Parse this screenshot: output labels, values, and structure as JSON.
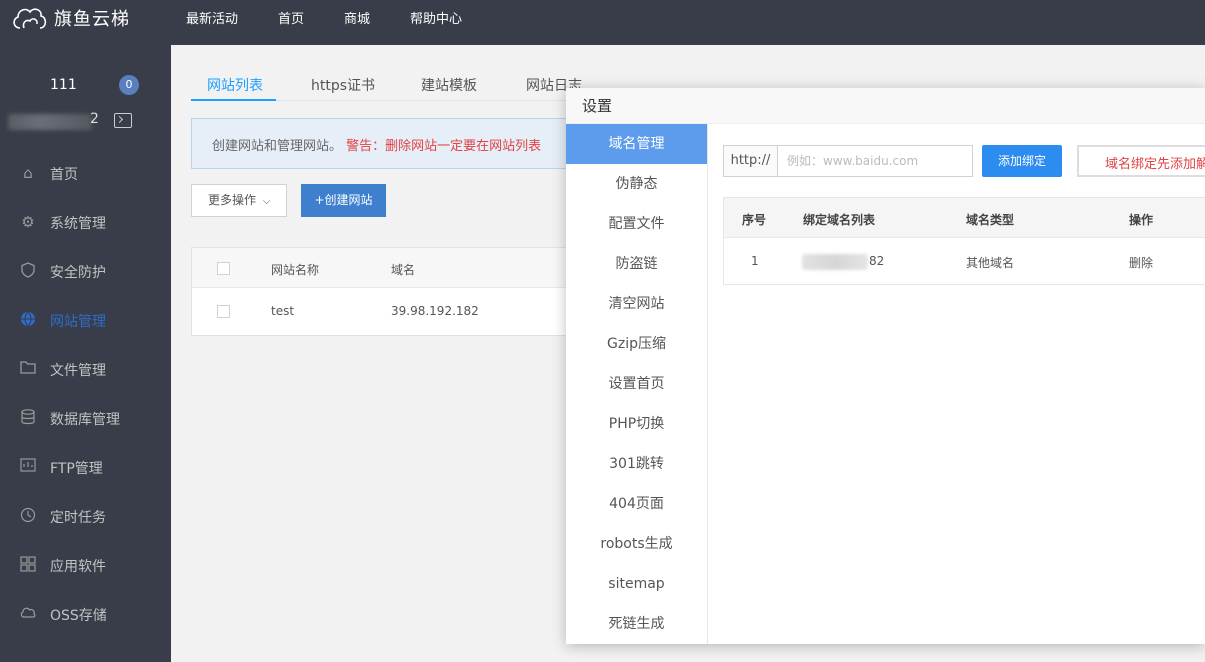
{
  "app": {
    "name": "旗鱼云梯",
    "top_nav": [
      "最新活动",
      "首页",
      "商城",
      "帮助中心"
    ]
  },
  "sidebar": {
    "username": "111",
    "badge_count": "0",
    "ip_suffix": "2",
    "items": [
      {
        "label": "首页",
        "icon": "home-icon"
      },
      {
        "label": "系统管理",
        "icon": "gear-icon"
      },
      {
        "label": "安全防护",
        "icon": "shield-icon"
      },
      {
        "label": "网站管理",
        "icon": "globe-icon",
        "active": true
      },
      {
        "label": "文件管理",
        "icon": "folder-icon"
      },
      {
        "label": "数据库管理",
        "icon": "database-icon"
      },
      {
        "label": "FTP管理",
        "icon": "ftp-icon"
      },
      {
        "label": "定时任务",
        "icon": "clock-icon"
      },
      {
        "label": "应用软件",
        "icon": "apps-icon"
      },
      {
        "label": "OSS存储",
        "icon": "cloud-icon"
      }
    ]
  },
  "main": {
    "tabs": [
      "网站列表",
      "https证书",
      "建站模板",
      "网站日志"
    ],
    "notice": {
      "text": "创建网站和管理网站。",
      "warning": "警告：删除网站一定要在网站列表"
    },
    "more_button": "更多操作",
    "create_button": "+创建网站",
    "table": {
      "headers": [
        "网站名称",
        "域名"
      ],
      "rows": [
        {
          "name": "test",
          "domain": "39.98.192.182"
        }
      ]
    }
  },
  "modal": {
    "title": "设置",
    "nav": [
      "域名管理",
      "伪静态",
      "配置文件",
      "防盗链",
      "清空网站",
      "Gzip压缩",
      "设置首页",
      "PHP切换",
      "301跳转",
      "404页面",
      "robots生成",
      "sitemap",
      "死链生成"
    ],
    "active_nav": "域名管理",
    "http_prefix": "http://",
    "domain_placeholder": "例如：www.baidu.com",
    "bind_button": "添加绑定",
    "bind_warning": "域名绑定先添加解",
    "table": {
      "headers": [
        "序号",
        "绑定域名列表",
        "域名类型",
        "操作"
      ],
      "rows": [
        {
          "index": "1",
          "domain_suffix": "82",
          "type": "其他域名",
          "action": "删除"
        }
      ]
    }
  }
}
